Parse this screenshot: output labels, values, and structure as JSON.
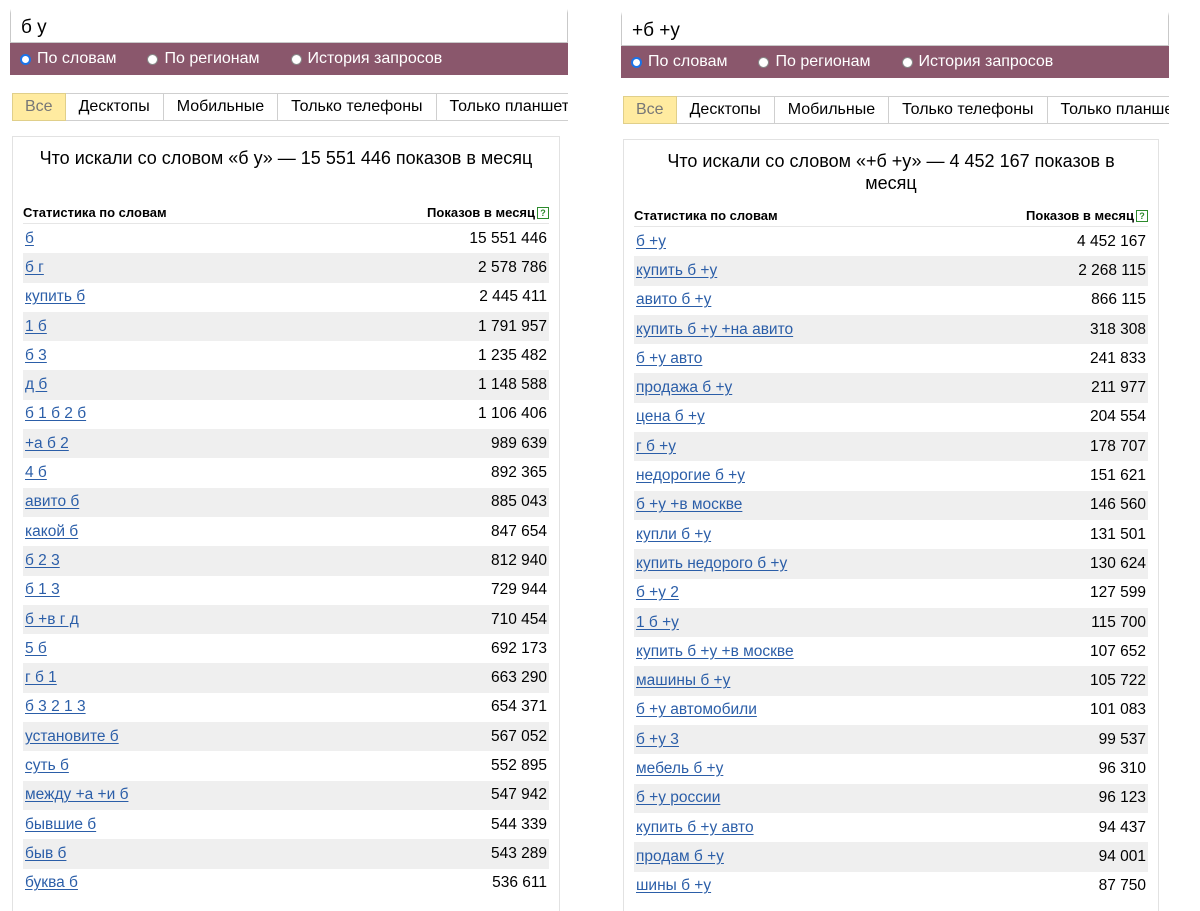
{
  "colors": {
    "header": "#8a576c",
    "active_tab": "#ffeba0",
    "link": "#2b5ea8",
    "row_alt": "#efefef"
  },
  "left": {
    "query": "б у",
    "radios": [
      "По словам",
      "По регионам",
      "История запросов"
    ],
    "tabs": [
      "Все",
      "Десктопы",
      "Мобильные",
      "Только телефоны",
      "Только планшеты"
    ],
    "title": "Что искали со словом «б у» — 15 551 446 показов в месяц",
    "col_left": "Статистика по словам",
    "col_right": "Показов в месяц",
    "rows": [
      {
        "kw": "б",
        "n": "15 551 446"
      },
      {
        "kw": "б г",
        "n": "2 578 786"
      },
      {
        "kw": "купить б",
        "n": "2 445 411"
      },
      {
        "kw": "1 б",
        "n": "1 791 957"
      },
      {
        "kw": "б 3",
        "n": "1 235 482"
      },
      {
        "kw": "д б",
        "n": "1 148 588"
      },
      {
        "kw": "б 1 б 2 б",
        "n": "1 106 406"
      },
      {
        "kw": "+а б 2",
        "n": "989 639"
      },
      {
        "kw": "4 б",
        "n": "892 365"
      },
      {
        "kw": "авито б",
        "n": "885 043"
      },
      {
        "kw": "какой б",
        "n": "847 654"
      },
      {
        "kw": "б 2 3",
        "n": "812 940"
      },
      {
        "kw": "б 1 3",
        "n": "729 944"
      },
      {
        "kw": "б +в г д",
        "n": "710 454"
      },
      {
        "kw": "5 б",
        "n": "692 173"
      },
      {
        "kw": "г б 1",
        "n": "663 290"
      },
      {
        "kw": "б 3 2 1 3",
        "n": "654 371"
      },
      {
        "kw": "установите б",
        "n": "567 052"
      },
      {
        "kw": "суть б",
        "n": "552 895"
      },
      {
        "kw": "между +а +и б",
        "n": "547 942"
      },
      {
        "kw": "бывшие б",
        "n": "544 339"
      },
      {
        "kw": "быв б",
        "n": "543 289"
      },
      {
        "kw": "буква б",
        "n": "536 611"
      }
    ]
  },
  "right": {
    "query": "+б +у",
    "radios": [
      "По словам",
      "По регионам",
      "История запросов"
    ],
    "tabs": [
      "Все",
      "Десктопы",
      "Мобильные",
      "Только телефоны",
      "Только планшеты"
    ],
    "title": "Что искали со словом «+б +у» — 4 452 167 показов в месяц",
    "col_left": "Статистика по словам",
    "col_right": "Показов в месяц",
    "rows": [
      {
        "kw": "б +у",
        "n": "4 452 167"
      },
      {
        "kw": "купить б +у",
        "n": "2 268 115"
      },
      {
        "kw": "авито б +у",
        "n": "866 115"
      },
      {
        "kw": "купить б +у +на авито",
        "n": "318 308"
      },
      {
        "kw": "б +у авто",
        "n": "241 833"
      },
      {
        "kw": "продажа б +у",
        "n": "211 977"
      },
      {
        "kw": "цена б +у",
        "n": "204 554"
      },
      {
        "kw": "г б +у",
        "n": "178 707"
      },
      {
        "kw": "недорогие б +у",
        "n": "151 621"
      },
      {
        "kw": "б +у +в москве",
        "n": "146 560"
      },
      {
        "kw": "купли б +у",
        "n": "131 501"
      },
      {
        "kw": "купить недорого б +у",
        "n": "130 624"
      },
      {
        "kw": "б +у 2",
        "n": "127 599"
      },
      {
        "kw": "1 б +у",
        "n": "115 700"
      },
      {
        "kw": "купить б +у +в москве",
        "n": "107 652"
      },
      {
        "kw": "машины б +у",
        "n": "105 722"
      },
      {
        "kw": "б +у автомобили",
        "n": "101 083"
      },
      {
        "kw": "б +у 3",
        "n": "99 537"
      },
      {
        "kw": "мебель б +у",
        "n": "96 310"
      },
      {
        "kw": "б +у россии",
        "n": "96 123"
      },
      {
        "kw": "купить б +у авто",
        "n": "94 437"
      },
      {
        "kw": "продам б +у",
        "n": "94 001"
      },
      {
        "kw": "шины б +у",
        "n": "87 750"
      }
    ]
  }
}
